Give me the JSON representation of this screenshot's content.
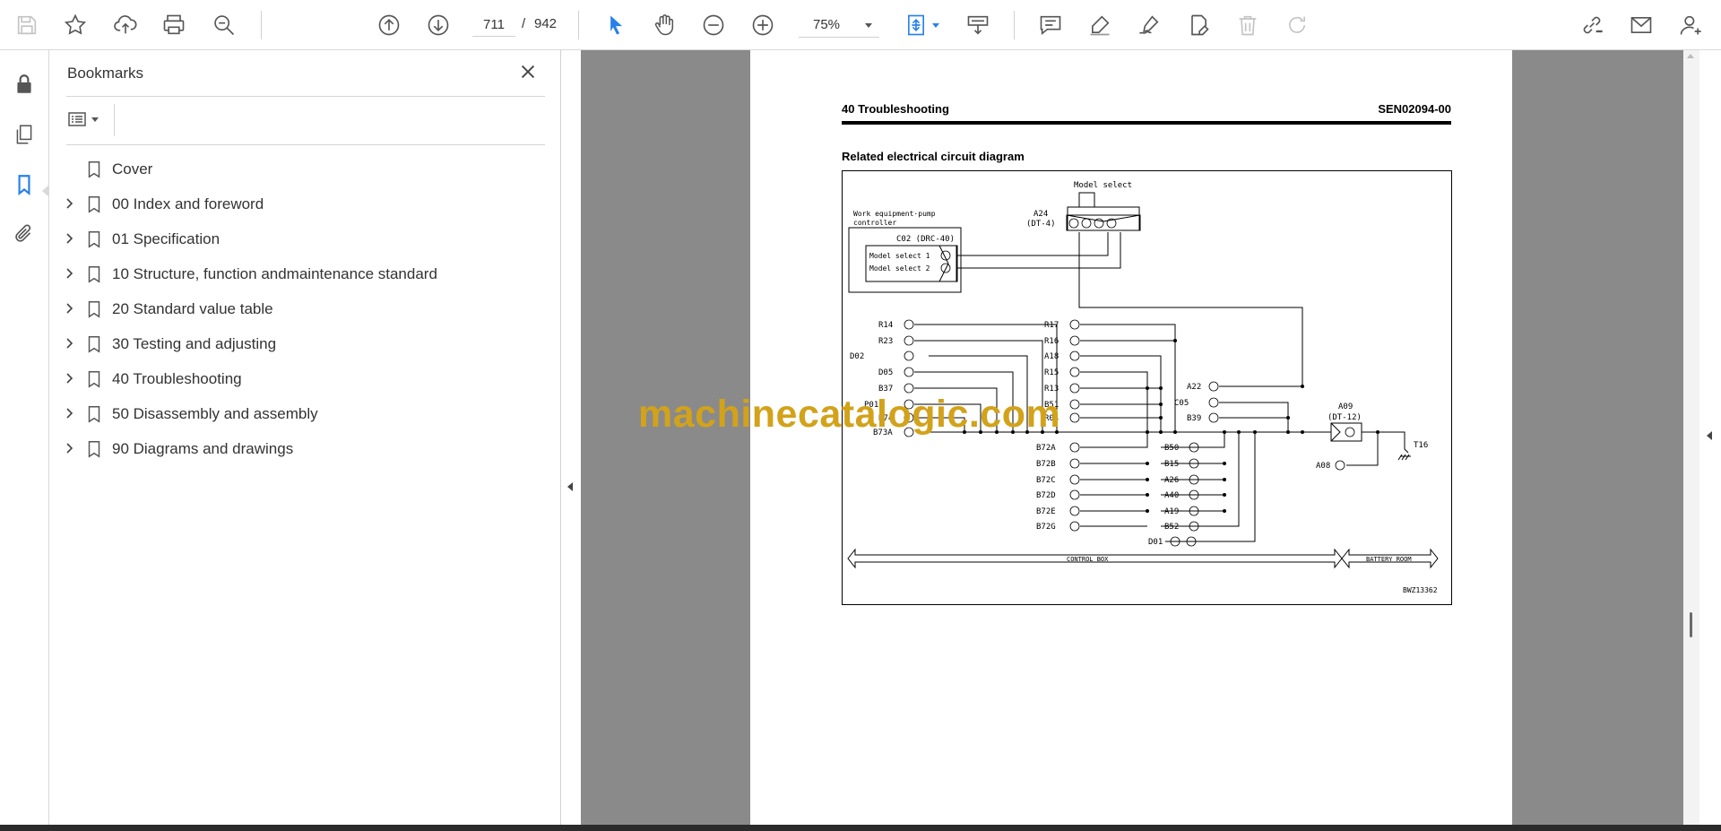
{
  "toolbar": {
    "page_current": "711",
    "page_separator": "/",
    "page_total": "942",
    "zoom": "75%",
    "icons": [
      "save-icon",
      "bookmark-star-icon",
      "upload-icon",
      "print-icon",
      "find-zoom-icon",
      "previous-page-icon",
      "next-page-icon",
      "select-arrow-icon",
      "hand-tool-icon",
      "zoom-out-icon",
      "zoom-in-icon",
      "fit-page-icon",
      "scroll-mode-icon",
      "comment-icon",
      "highlight-icon",
      "sign-icon",
      "fill-sign-icon",
      "delete-icon",
      "redo-icon",
      "share-link-icon",
      "email-icon",
      "account-icon"
    ]
  },
  "panel": {
    "title": "Bookmarks",
    "bookmarks": [
      {
        "label": "Cover",
        "expandable": false
      },
      {
        "label": "00 Index and foreword",
        "expandable": true
      },
      {
        "label": "01 Specification",
        "expandable": true
      },
      {
        "label": "10 Structure, function andmaintenance standard",
        "expandable": true
      },
      {
        "label": "20 Standard value table",
        "expandable": true
      },
      {
        "label": "30 Testing and adjusting",
        "expandable": true
      },
      {
        "label": "40 Troubleshooting",
        "expandable": true
      },
      {
        "label": "50 Disassembly and assembly",
        "expandable": true
      },
      {
        "label": "90 Diagrams and drawings",
        "expandable": true
      }
    ]
  },
  "document": {
    "header_left": "40 Troubleshooting",
    "header_right": "SEN02094-00",
    "section_title": "Related electrical circuit diagram",
    "watermark": "machinecatalogic.com",
    "diagram": {
      "model_select": "Model select",
      "controller_1": "Work equipment·pump",
      "controller_2": "controller",
      "c02": "C02 (DRC-40)",
      "ms1": "Model select 1",
      "ms2": "Model select 2",
      "a24": "A24",
      "dt4": "(DT-4)",
      "a09": "A09",
      "dt12": "(DT-12)",
      "t16": "T16",
      "a08": "A08",
      "control_box": "CONTROL BOX",
      "battery_room": "BATTERY ROOM",
      "code": "BWZ13362",
      "left_labels": [
        "R14",
        "R23",
        "D02",
        "D05",
        "B37",
        "P01",
        "B74",
        "B73A"
      ],
      "mid_labels": [
        "R17",
        "R16",
        "A18",
        "R15",
        "R13",
        "B51",
        "R04"
      ],
      "bottom_labels": [
        "B72A",
        "B72B",
        "B72C",
        "B72D",
        "B72E",
        "B72G"
      ],
      "right_labels": [
        "B50",
        "B15",
        "A26",
        "A40",
        "A19",
        "B52",
        "D01"
      ],
      "a22": "A22",
      "c05": "C05",
      "b39": "B39"
    }
  }
}
